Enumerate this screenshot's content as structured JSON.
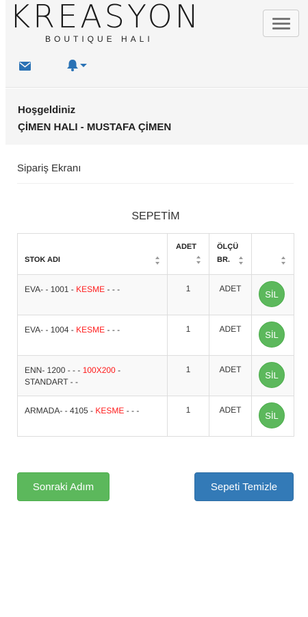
{
  "brand": {
    "name": "KREASYON",
    "tagline": "BOUTIQUE HALI"
  },
  "header": {
    "icons": [
      "menu-icon",
      "envelope-icon",
      "bell-icon",
      "caret-down-icon"
    ],
    "accent_color": "#2a72b5"
  },
  "welcome": {
    "greeting": "Hoşgeldiniz",
    "user": "ÇİMEN HALI - MUSTAFA ÇİMEN"
  },
  "page": {
    "title": "Sipariş Ekranı"
  },
  "cart": {
    "title": "SEPETİM",
    "columns": {
      "name": "STOK ADI",
      "qty": "ADET",
      "unit_1": "ÖLÇÜ",
      "unit_2": "BR."
    },
    "rows": [
      {
        "name_prefix": "EVA- - 1001 - ",
        "name_highlight": "KESME",
        "name_suffix": " - - -",
        "name_line2": "",
        "qty": "1",
        "unit": "ADET",
        "action": "SİL"
      },
      {
        "name_prefix": "EVA- - 1004 - ",
        "name_highlight": "KESME",
        "name_suffix": " - - -",
        "name_line2": "",
        "qty": "1",
        "unit": "ADET",
        "action": "SİL"
      },
      {
        "name_prefix": "ENN- 1200 - - - ",
        "name_highlight": "100X200",
        "name_suffix": " -",
        "name_line2": "STANDART - -",
        "qty": "1",
        "unit": "ADET",
        "action": "SİL"
      },
      {
        "name_prefix": "ARMADA- - 4105 - ",
        "name_highlight": "KESME",
        "name_suffix": " - - -",
        "name_line2": "",
        "qty": "1",
        "unit": "ADET",
        "action": "SİL"
      }
    ],
    "highlight_color": "#ff1a1a",
    "action_color": "#5cb85c"
  },
  "actions": {
    "next_label": "Sonraki Adım",
    "next_color": "#5cb85c",
    "clear_label": "Sepeti Temizle",
    "clear_color": "#337ab7"
  }
}
